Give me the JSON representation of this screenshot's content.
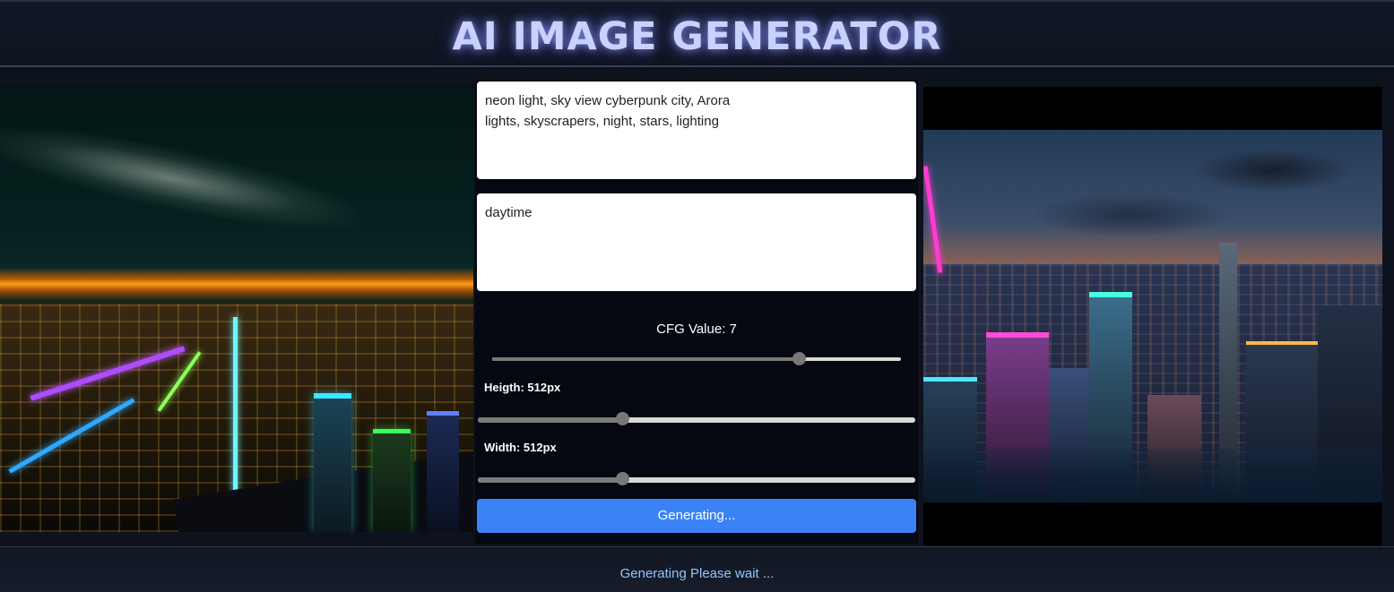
{
  "header": {
    "title": "AI IMAGE GENERATOR"
  },
  "prompt": {
    "value": "neon light, sky view cyberpunk city, Arora\nlights, skyscrapers, night, stars, lighting"
  },
  "negative_prompt": {
    "value": "daytime"
  },
  "cfg": {
    "label": "CFG Value: 7",
    "value": 7,
    "fraction": 0.75
  },
  "height": {
    "label": "Heigth: 512px",
    "fraction": 0.33
  },
  "width": {
    "label": "Width: 512px",
    "fraction": 0.33
  },
  "generate_button": {
    "label": "Generating..."
  },
  "status": {
    "text": "Generating Please wait ..."
  },
  "colors": {
    "accent": "#3b82f6",
    "status_text": "#93c5fd",
    "title_glow": "#c9d2ff"
  }
}
